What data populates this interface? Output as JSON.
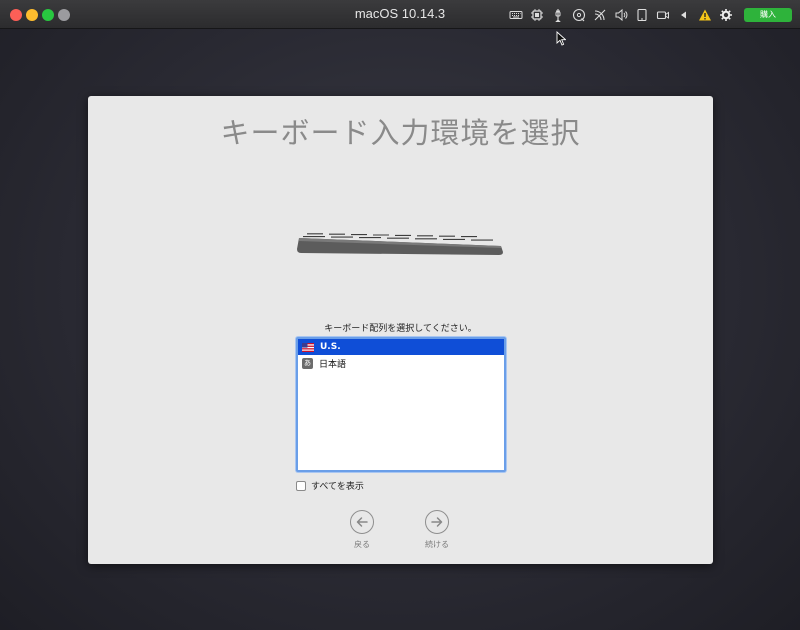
{
  "window": {
    "title": "macOS 10.14.3",
    "buy_label": "購入",
    "toolbar_icons": [
      "keyboard-icon",
      "cpu-icon",
      "usb-icon",
      "cd-icon",
      "network-icon",
      "volume-icon",
      "tablet-icon",
      "camera-icon",
      "play-icon",
      "warning-icon",
      "gear-icon"
    ]
  },
  "setup": {
    "title": "キーボード入力環境を選択",
    "prompt": "キーボード配列を選択してください。",
    "layouts": [
      {
        "label": "U.S.",
        "icon": "us-flag-icon",
        "selected": true
      },
      {
        "label": "日本語",
        "icon": "japanese-input-icon",
        "selected": false
      }
    ],
    "jp_icon_glyph": "あ",
    "show_all_label": "すべてを表示",
    "show_all_checked": false,
    "back_label": "戻る",
    "continue_label": "続ける"
  },
  "colors": {
    "selection": "#0f4ed7",
    "buy_button": "#2eb33b",
    "close": "#fc5f57",
    "minimize": "#fdbc2e",
    "zoom": "#28c840"
  }
}
